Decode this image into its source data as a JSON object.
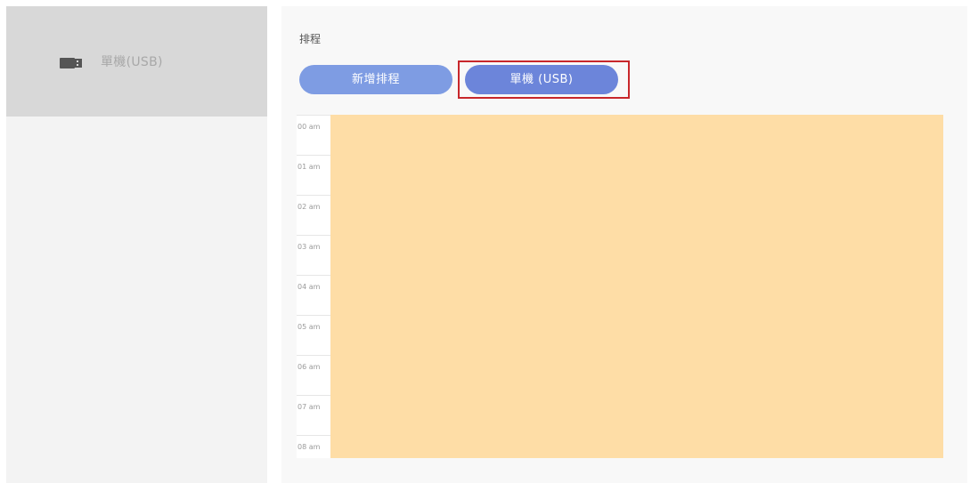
{
  "sidebar": {
    "items": [
      {
        "label": "單機(USB)",
        "icon": "usb-drive-icon"
      }
    ]
  },
  "main": {
    "title": "排程",
    "buttons": {
      "add_schedule": "新增排程",
      "usb": "單機 (USB)"
    },
    "time_labels": [
      "00 am",
      "01 am",
      "02 am",
      "03 am",
      "04 am",
      "05 am",
      "06 am",
      "07 am",
      "08 am"
    ]
  },
  "colors": {
    "accent": "#6c85da",
    "accent_light": "#7e9ce3",
    "schedule_block": "#fedda6",
    "highlight": "#c8272b"
  }
}
